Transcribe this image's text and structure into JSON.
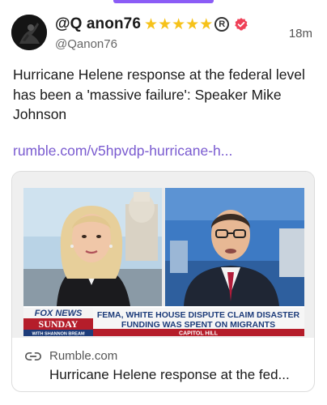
{
  "user": {
    "display_name": "@Q anon76",
    "handle": "@Qanon76",
    "star_count": 5,
    "registered_mark": "R",
    "timestamp": "18m"
  },
  "post": {
    "text": "Hurricane Helene response at the federal level has been a 'massive failure': Speaker Mike Johnson",
    "link": "rumble.com/v5hpvdp-hurricane-h..."
  },
  "card": {
    "domain": "Rumble.com",
    "title": "Hurricane Helene response at the fed...",
    "thumbnail": {
      "network": "FOX NEWS",
      "show": "SUNDAY",
      "anchor": "WITH SHANNON BREAM",
      "headline_line1": "FEMA, WHITE HOUSE DISPUTE CLAIM DISASTER",
      "headline_line2": "FUNDING WAS SPENT ON MIGRANTS",
      "location": "CAPITOL HILL"
    }
  },
  "colors": {
    "accent": "#7a5bd0",
    "star": "#f6c21a",
    "verified": "#ef4057"
  }
}
